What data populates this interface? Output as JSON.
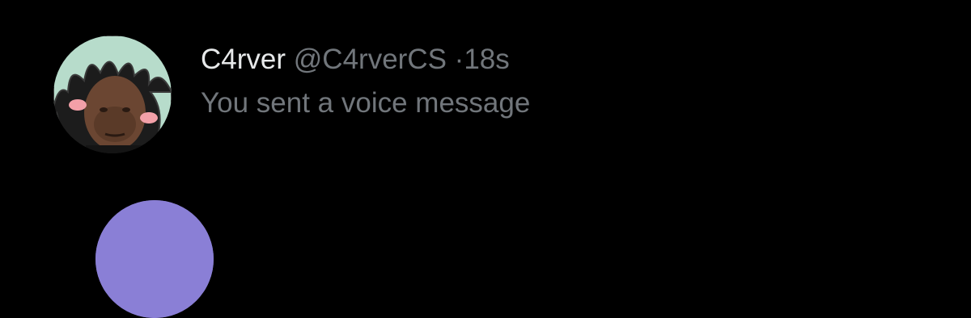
{
  "conversations": [
    {
      "display_name": "C4rver",
      "handle": "@C4rverCS",
      "separator": "·",
      "timestamp": "18s",
      "preview": "You sent a voice message",
      "avatar_icon": "profile-photo-icon"
    },
    {
      "avatar_icon": "profile-photo-icon",
      "avatar_color": "#8a7fd6"
    }
  ],
  "colors": {
    "background": "#000000",
    "primary_text": "#e7e9ea",
    "secondary_text": "#71767b"
  }
}
